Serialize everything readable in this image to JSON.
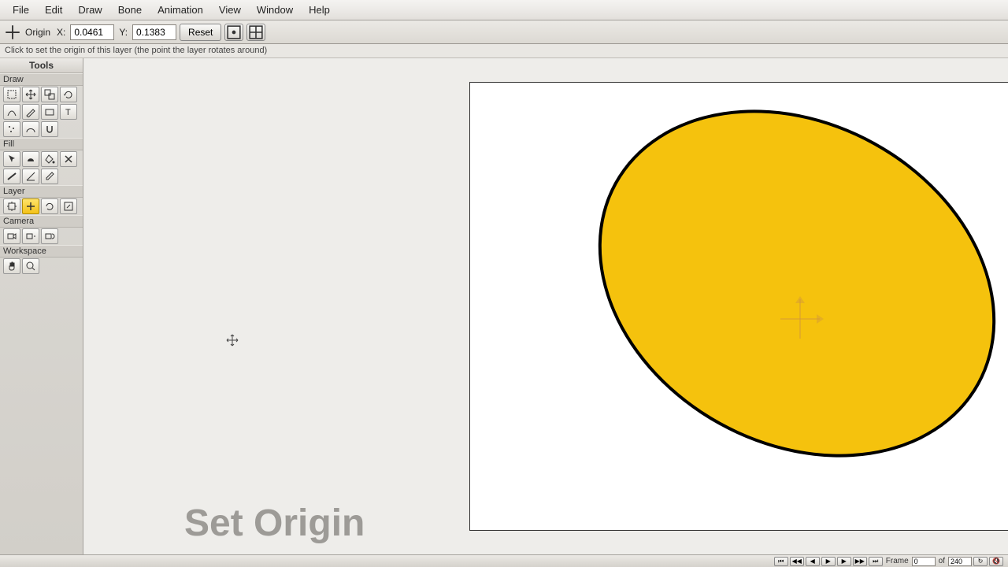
{
  "menu": {
    "items": [
      "File",
      "Edit",
      "Draw",
      "Bone",
      "Animation",
      "View",
      "Window",
      "Help"
    ]
  },
  "options": {
    "tool_label": "Origin",
    "x_label": "X:",
    "y_label": "Y:",
    "x_value": "0.0461",
    "y_value": "0.1383",
    "reset_label": "Reset"
  },
  "hint": "Click to set the origin of this layer (the point the layer rotates around)",
  "tools": {
    "title": "Tools",
    "groups": {
      "draw": "Draw",
      "fill": "Fill",
      "layer": "Layer",
      "camera": "Camera",
      "workspace": "Workspace"
    }
  },
  "overlay": {
    "text": "Set Origin"
  },
  "timeline": {
    "frame_label": "Frame",
    "frame_value": "0",
    "of_label": "of",
    "total_value": "240"
  },
  "shape": {
    "fill_color": "#f5c20d",
    "stroke_color": "#000000"
  }
}
